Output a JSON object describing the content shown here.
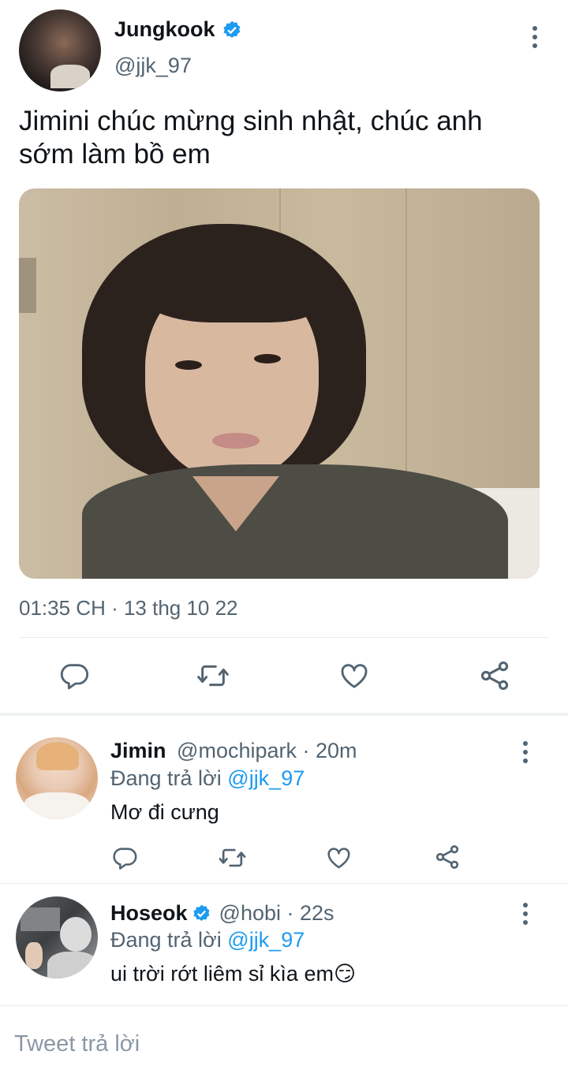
{
  "tweet": {
    "author_name": "Jungkook",
    "author_handle": "@jjk_97",
    "text_line1": "Jimini chúc mừng sinh nhật, chúc anh",
    "text_line2": "sớm làm bồ em",
    "timestamp": "01:35 CH · 13 thg 10 22"
  },
  "replies": [
    {
      "name": "Jimin",
      "meta": "@mochipark · 20m",
      "replying_prefix": "Đang trả lời",
      "replying_to": "@jjk_97",
      "text": "Mơ đi cưng"
    },
    {
      "name": "Hoseok",
      "meta": "@hobi · 22s",
      "replying_prefix": "Đang trả lời",
      "replying_to": "@jjk_97",
      "text": "ui trời rớt liêm sỉ kìa em",
      "emoji": "😏"
    }
  ],
  "reply_box": {
    "placeholder": "Tweet trả lời"
  },
  "colors": {
    "accent": "#1d9bf0",
    "muted": "#536471",
    "divider": "#e6ecf0"
  }
}
